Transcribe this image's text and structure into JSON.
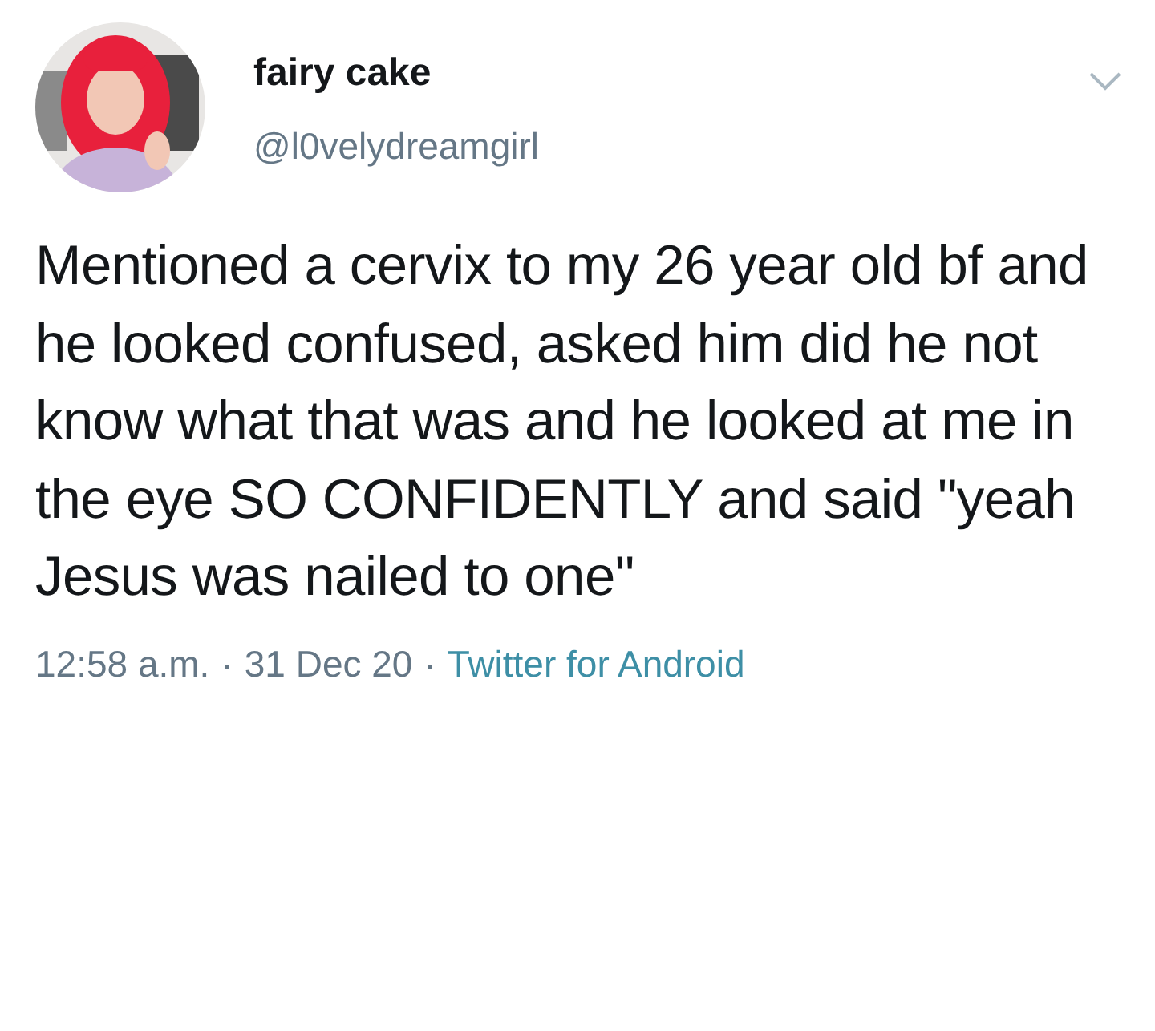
{
  "author": {
    "name": "fairy cake",
    "handle": "@l0velydreamgirl"
  },
  "tweet": {
    "text": "Mentioned a cervix to my 26 year old bf and he looked confused, asked him did he not know what that was and he looked at me in the eye SO CONFIDENTLY and said \"yeah Jesus was nailed to one\""
  },
  "footer": {
    "time": "12:58 a.m.",
    "separator_1": "·",
    "date": "31 Dec 20",
    "separator_2": "·",
    "source": "Twitter for Android"
  }
}
